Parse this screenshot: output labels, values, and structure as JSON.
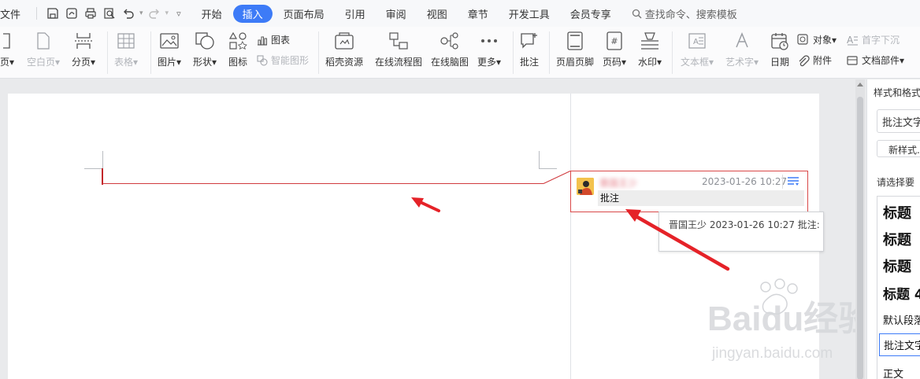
{
  "menubar": {
    "file": "文件",
    "tabs": [
      "开始",
      "插入",
      "页面布局",
      "引用",
      "审阅",
      "视图",
      "章节",
      "开发工具",
      "会员专享"
    ],
    "active_tab": "插入",
    "search_placeholder": "查找命令、搜索模板"
  },
  "ribbon": {
    "page_partial": "页",
    "blank_page": "空白页",
    "page_break": "分页",
    "table": "表格",
    "picture": "图片",
    "shape": "形状",
    "icon": "图标",
    "chart": "图表",
    "smart_graphic": "智能图形",
    "docer_resources": "稻壳资源",
    "online_flowchart": "在线流程图",
    "online_mindmap": "在线脑图",
    "more": "更多",
    "comment": "批注",
    "header_footer": "页眉页脚",
    "page_number": "页码",
    "watermark": "水印",
    "textbox": "文本框",
    "wordart": "艺术字",
    "date": "日期",
    "object": "对象",
    "drop_cap": "首字下沉",
    "attachment": "附件",
    "doc_parts": "文档部件"
  },
  "comment": {
    "author": "晋国王少",
    "date": "2023-01-26 10:27",
    "text": "批注"
  },
  "tooltip": {
    "text": "晋国王少 2023-01-26 10:27 批注:"
  },
  "pane": {
    "title": "样式和格式",
    "current_style": "批注文字",
    "new_style": "新样式...",
    "subtitle": "请选择要",
    "styles": [
      "标题",
      "标题",
      "标题",
      "标题 4",
      "默认段落",
      "批注文字",
      "正文"
    ]
  },
  "watermark": {
    "brand": "Baidu经验",
    "url": "jingyan.baidu.com"
  },
  "colors": {
    "accent": "#3d7bf7",
    "comment_border": "#d94848",
    "arrow": "#e52228"
  }
}
